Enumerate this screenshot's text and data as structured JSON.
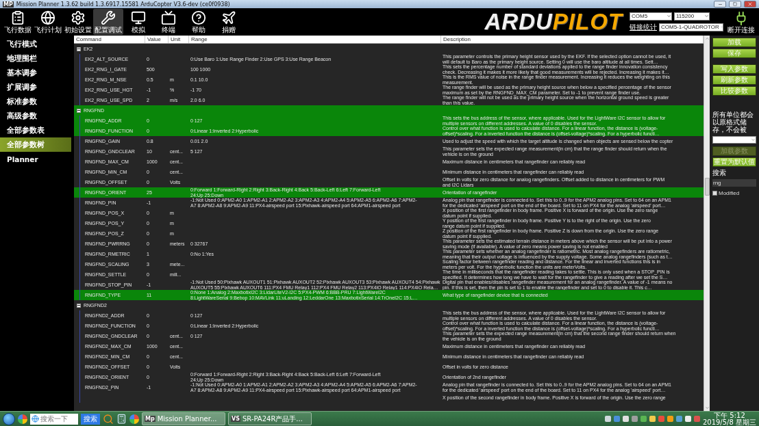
{
  "window": {
    "icon_text": "MP",
    "title": "Mission Planner 1.3.62 build 1.3.6917.15581 ArduCopter V3.6-dev (ce0f0938)"
  },
  "toolbar": [
    {
      "label": "飞行数据",
      "kind": "clipboard",
      "selected": false
    },
    {
      "label": "飞行计划",
      "kind": "globe",
      "selected": false
    },
    {
      "label": "初始设置",
      "kind": "gear",
      "selected": false
    },
    {
      "label": "配置调试",
      "kind": "wrench",
      "selected": true
    },
    {
      "label": "模拟",
      "kind": "monitor",
      "selected": false
    },
    {
      "label": "终端",
      "kind": "tv",
      "selected": false
    },
    {
      "label": "帮助",
      "kind": "help",
      "selected": false
    },
    {
      "label": "捐赠",
      "kind": "plane",
      "selected": false
    }
  ],
  "logo": {
    "lead": "ARDU",
    "accent": "PILOT"
  },
  "connection": {
    "port": "COM5",
    "baud": "115200",
    "stats_label": "链接统计",
    "profile": "COM5-1-QUADROTOR",
    "connect_label": "断开连接"
  },
  "sidebar": [
    {
      "label": "飞行模式",
      "selected": false
    },
    {
      "label": "地理围栏",
      "selected": false
    },
    {
      "label": "基本调参",
      "selected": false
    },
    {
      "label": "扩展调参",
      "selected": false
    },
    {
      "label": "标准参数",
      "selected": false
    },
    {
      "label": "高级参数",
      "selected": false
    },
    {
      "label": "全部参数表",
      "selected": false
    },
    {
      "label": "全部参数树",
      "selected": true
    },
    {
      "label": "Planner",
      "selected": false
    }
  ],
  "table": {
    "columns": [
      "Command",
      "Value",
      "Unit",
      "Range",
      "Description"
    ],
    "groups": [
      {
        "name": "EK2",
        "expanded": true,
        "selected": false,
        "rows": [
          {
            "name": "EK2_ALT_SOURCE",
            "value": "0",
            "range": "0:Use Baro 1:Use Range Finder 2:Use GPS 3:Use Range Beacon",
            "description": "This parameter controls the primary height sensor used by the EKF. If the selected option cannot be used, it\nwill default to Baro as the primary height source. Setting 0 will use the baro altitude at all times. Sett…",
            "selected": false
          },
          {
            "name": "EK2_RNG_I_GATE",
            "value": "500",
            "range": "100 1000",
            "description": "This sets the percentage number of standard deviations applied to the range finder innovation consistency\ncheck. Decreasing it makes it more likely that good measurements will be rejected. Increasing it makes it…",
            "selected": false
          },
          {
            "name": "EK2_RNG_M_NSE",
            "value": "0.5",
            "unit": "m",
            "range": "0.1 10.0",
            "description": "This is the RMS value of noise in the range finder measurement. Increasing it reduces the weighting on this\nmeasurement.",
            "selected": false
          },
          {
            "name": "EK2_RNG_USE_HGT",
            "value": "-1",
            "unit": "%",
            "range": "-1 70",
            "description": "The range finder will be used as the primary height source when below a specified percentage of the sensor\nmaximum as set by the RNGFND_MAX_CM parameter. Set to -1 to prevent range finder use.",
            "selected": false
          },
          {
            "name": "EK2_RNG_USE_SPD",
            "value": "2",
            "unit": "m/s",
            "range": "2.0 6.0",
            "description": "The range finder will not be used as the primary height source when the horizontal ground speed is greater\nthan this value.",
            "selected": false
          }
        ]
      },
      {
        "name": "RNGFND",
        "expanded": true,
        "selected": true,
        "rows": [
          {
            "name": "RNGFND_ADDR",
            "value": "0",
            "range": "0 127",
            "description": "This sets the bus address of the sensor, where applicable. Used for the LightWare I2C sensor to allow for\nmultiple sensors on different addresses. A value of 0 disables the sensor.",
            "selected": true
          },
          {
            "name": "RNGFND_FUNCTION",
            "value": "0",
            "range": "0:Linear 1:Inverted 2:Hyperbolic",
            "description": "Control over what function is used to calculate distance. For a linear function, the distance is (voltage-\noffset)*scaling. For a inverted function the distance is (offset-voltage)*scaling. For a hyperbolic functi…",
            "selected": true
          },
          {
            "name": "RNGFND_GAIN",
            "value": "0.8",
            "range": "0.01 2.0",
            "description": "Used to adjust the speed with which the target altitude is changed when objects are sensed below the copter",
            "selected": false
          },
          {
            "name": "RNGFND_GNDCLEAR",
            "value": "10",
            "unit": "cent...",
            "range": "5 127",
            "description": "This parameter sets the expected range measurement(in cm) that the range finder should return when the\nvehicle is on the ground",
            "selected": false
          },
          {
            "name": "RNGFND_MAX_CM",
            "value": "1000",
            "unit": "cent...",
            "description": "Maximum distance in centimeters that rangefinder can reliably read",
            "selected": false
          },
          {
            "name": "RNGFND_MIN_CM",
            "value": "0",
            "unit": "cent...",
            "description": "Minimum distance in centimeters that rangefinder can reliably read",
            "selected": false
          },
          {
            "name": "RNGFND_OFFSET",
            "value": "0",
            "unit": "Volts",
            "description": "Offset in volts for zero distance for analog rangefinders. Offset added to distance in centimeters for PWM\nand I2C Lidars",
            "selected": false
          },
          {
            "name": "RNGFND_ORIENT",
            "value": "25",
            "range": "0:Forward 1:Forward-Right 2:Right 3:Back-Right 4:Back 5:Back-Left 6:Left 7:Forward-Left\n24:Up 25:Down",
            "description": "Orientation of rangefinder",
            "selected": true
          },
          {
            "name": "RNGFND_PIN",
            "value": "-1",
            "range": "-1:Not Used 0:APM2-A0 1:APM2-A1 2:APM2-A2 3:APM2-A3 4:APM2-A4 5:APM2-A5 6:APM2-A6 7:APM2-\nA7 8:APM2-A8 9:APM2-A9 11:PX4-airspeed port 15:Pixhawk-airspeed port 64:APM1-airspeed port",
            "description": "Analog pin that rangefinder is connected to. Set this to 0..9 for the APM2 analog pins. Set to 64 on an APM1\nfor the dedicated 'airspeed' port on the end of the board. Set to 11 on PX4 for the analog 'airspeed' port…",
            "selected": false
          },
          {
            "name": "RNGFND_POS_X",
            "value": "0",
            "unit": "m",
            "description": "X position of the first rangefinder in body frame. Positive X is forward of the origin. Use the zero range\ndatum point if supplied.",
            "selected": false
          },
          {
            "name": "RNGFND_POS_Y",
            "value": "0",
            "unit": "m",
            "description": "Y position of the first rangefinder in body frame. Positive Y is to the right of the origin. Use the zero\nrange datum point if supplied.",
            "selected": false
          },
          {
            "name": "RNGFND_POS_Z",
            "value": "0",
            "unit": "m",
            "description": "Z position of the first rangefinder in body frame. Positive Z is down from the origin. Use the zero range\ndatum point if supplied.",
            "selected": false
          },
          {
            "name": "RNGFND_PWRRNG",
            "value": "0",
            "unit": "meters",
            "range": "0 32767",
            "description": "This parameter sets the estimated terrain distance in meters above which the sensor will be put into a power\nsaving mode (if available). A value of zero means power saving is not enabled",
            "selected": false
          },
          {
            "name": "RNGFND_RMETRIC",
            "value": "1",
            "range": "0:No 1:Yes",
            "description": "This parameter sets whether an analog rangefinder is ratiometric. Most analog rangefinders are ratiometric,\nmeaning that their output voltage is influenced by the supply voltage. Some analog rangefinders (such as t…",
            "selected": false
          },
          {
            "name": "RNGFND_SCALING",
            "value": "3",
            "unit": "mete...",
            "description": "Scaling factor between rangefinder reading and distance. For the linear and inverted functions this is in\nmeters per volt. For the hyperbolic function the units are meterVolts.",
            "selected": false
          },
          {
            "name": "RNGFND_SETTLE",
            "value": "0",
            "unit": "mill...",
            "description": "The time in milliseconds that the rangefinder reading takes to settle. This is only used when a STOP_PIN is\nspecified. It determines how long we have to wait for the rangefinder to give a reading after we set the S…",
            "selected": false
          },
          {
            "name": "RNGFND_STOP_PIN",
            "value": "-1",
            "range": "-1:Not Used 50:Pixhawk AUXOUT1 51:Pixhawk AUXOUT2 52:Pixhawk AUXOUT3 53:Pixhawk AUXOUT4 54:Pixhawk\nAUXOUT5 55:Pixhawk AUXOUT6 111:PX4 FMU Relay1 112:PX4 FMU Relay2 113:PX4IO Relay1 114:PX4IO Rela…",
            "description": "Digital pin that enables/disables rangefinder measurement for an analog rangefinder. A value of -1 means no\npin. If this is set, then the pin is set to 1 to enable the rangefinder and set to 0 to disable it. This c…",
            "selected": false
          },
          {
            "name": "RNGFND_TYPE",
            "value": "11",
            "range": "0:None 1:Analog 2:MaxbotixI2C 3:LidarLiteV2-I2C 5:PX4-PWM 6:BBB-PRU 7:LightWareI2C\n8:LightWareSerial 9:Bebop 10:MAVLink 11:uLanding 12:LeddarOne 13:MaxbotixSerial 14:TrOneI2C 15:L…",
            "description": "What type of rangefinder device that is connected",
            "selected": true
          }
        ]
      },
      {
        "name": "RNGFND2",
        "expanded": true,
        "selected": false,
        "rows": [
          {
            "name": "RNGFND2_ADDR",
            "value": "0",
            "range": "0 127",
            "description": "This sets the bus address of the sensor, where applicable. Used for the LightWare I2C sensor to allow for\nmultiple sensors on different addresses. A value of 0 disables the sensor.",
            "selected": false
          },
          {
            "name": "RNGFND2_FUNCTION",
            "value": "0",
            "range": "0:Linear 1:Inverted 2:Hyperbolic",
            "description": "Control over what function is used to calculate distance. For a linear function, the distance is (voltage-\noffset)*scaling. For a inverted function the distance is (offset-voltage)*scaling. For a hyperbolic functi…",
            "selected": false
          },
          {
            "name": "RNGFND2_GNDCLEAR",
            "value": "0",
            "unit": "cent...",
            "range": "0 127",
            "description": "This parameter sets the expected range measurement(in cm) that the second range finder should return when\nthe vehicle is on the ground",
            "selected": false
          },
          {
            "name": "RNGFND2_MAX_CM",
            "value": "1000",
            "unit": "cent...",
            "description": "Maximum distance in centimeters that rangefinder can reliably read",
            "selected": false
          },
          {
            "name": "RNGFND2_MIN_CM",
            "value": "0",
            "unit": "cent...",
            "description": "Minimum distance in centimeters that rangefinder can reliably read",
            "selected": false
          },
          {
            "name": "RNGFND2_OFFSET",
            "value": "0",
            "unit": "Volts",
            "description": "Offset in volts for zero distance",
            "selected": false
          },
          {
            "name": "RNGFND2_ORIENT",
            "value": "0",
            "range": "0:Forward 1:Forward-Right 2:Right 3:Back-Right 4:Back 5:Back-Left 6:Left 7:Forward-Left\n24:Up 25:Down",
            "description": "Orientation of 2nd rangefinder",
            "selected": false
          },
          {
            "name": "RNGFND2_PIN",
            "value": "-1",
            "range": "-1:Not Used 0:APM2-A0 1:APM2-A1 2:APM2-A2 3:APM2-A3 4:APM2-A4 5:APM2-A5 6:APM2-A6 7:APM2-\nA7 8:APM2-A8 9:APM2-A9 11:PX4-airspeed port 15:Pixhawk-airspeed port 64:APM1-airspeed port",
            "description": "Analog pin that rangefinder is connected to. Set this to 0..9 for the APM2 analog pins. Set to 64 on an APM1\nfor the dedicated 'airspeed' port on the end of the board. Set to 11 on PX4 for the analog 'airspeed' port…",
            "selected": false
          },
          {
            "description": "X position of the second rangefinder in body frame. Positive X is forward of the origin. Use the zero range",
            "selected": false
          }
        ]
      }
    ]
  },
  "panel": {
    "buttons": [
      {
        "label": "加载",
        "disabled": false
      },
      {
        "label": "保存",
        "disabled": false
      },
      {
        "label": "写入参数",
        "disabled": false
      },
      {
        "label": "刷新参数",
        "disabled": false
      },
      {
        "label": "比较参数",
        "disabled": false
      }
    ],
    "note": "所有单位都会以原格式储存，不会被",
    "buttons2": [
      {
        "label": "加载参数",
        "disabled": true
      },
      {
        "label": "重置为默认值",
        "disabled": false
      }
    ],
    "search": {
      "label": "搜索",
      "value": "rng"
    },
    "modified": {
      "label": "Modified",
      "checked": false
    }
  },
  "taskbar": {
    "search_placeholder": "搜索一下",
    "search_button": "搜索",
    "tasks": [
      {
        "badge": "Mp",
        "label": "Mission Planner...",
        "selected": true
      },
      {
        "badge": "VS",
        "label": "SR-PA24R产品手...",
        "selected": false
      }
    ],
    "time": "下午 5:12",
    "date": "2019/5/8 星期三"
  }
}
